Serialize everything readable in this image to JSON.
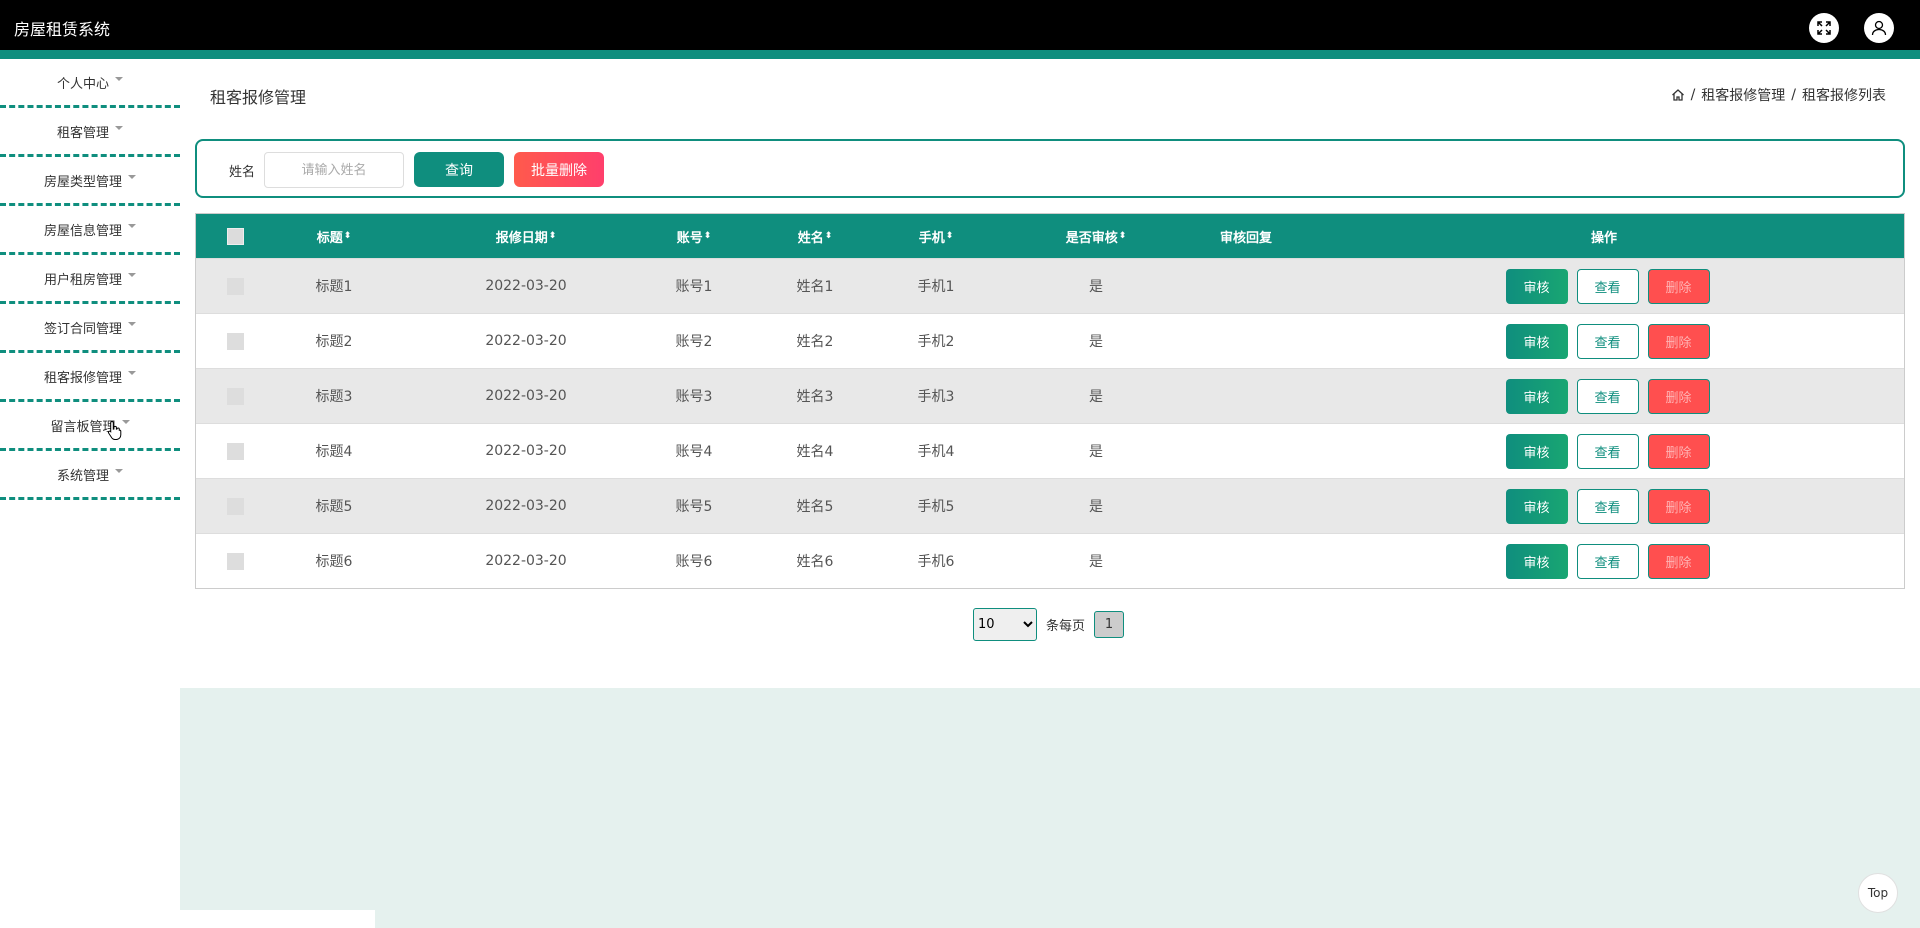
{
  "header": {
    "title": "房屋租赁系统",
    "fullscreen_icon": "fullscreen-icon",
    "user_icon": "user-icon"
  },
  "sidebar": {
    "items": [
      {
        "label": "个人中心"
      },
      {
        "label": "租客管理"
      },
      {
        "label": "房屋类型管理"
      },
      {
        "label": "房屋信息管理"
      },
      {
        "label": "用户租房管理"
      },
      {
        "label": "签订合同管理"
      },
      {
        "label": "租客报修管理"
      },
      {
        "label": "留言板管理"
      },
      {
        "label": "系统管理"
      }
    ]
  },
  "main": {
    "page_title": "租客报修管理",
    "breadcrumb": [
      "租客报修管理",
      "租客报修列表"
    ],
    "breadcrumb_sep": "/",
    "search": {
      "label": "姓名",
      "placeholder": "请输入姓名",
      "query_label": "查询",
      "batch_delete_label": "批量删除"
    },
    "table": {
      "columns": [
        "标题",
        "报修日期",
        "账号",
        "姓名",
        "手机",
        "是否审核",
        "审核回复",
        "操作"
      ],
      "sort_glyph": "⬍",
      "rows": [
        {
          "title": "标题1",
          "date": "2022-03-20",
          "account": "账号1",
          "name": "姓名1",
          "phone": "手机1",
          "audited": "是",
          "reply": ""
        },
        {
          "title": "标题2",
          "date": "2022-03-20",
          "account": "账号2",
          "name": "姓名2",
          "phone": "手机2",
          "audited": "是",
          "reply": ""
        },
        {
          "title": "标题3",
          "date": "2022-03-20",
          "account": "账号3",
          "name": "姓名3",
          "phone": "手机3",
          "audited": "是",
          "reply": ""
        },
        {
          "title": "标题4",
          "date": "2022-03-20",
          "account": "账号4",
          "name": "姓名4",
          "phone": "手机4",
          "audited": "是",
          "reply": ""
        },
        {
          "title": "标题5",
          "date": "2022-03-20",
          "account": "账号5",
          "name": "姓名5",
          "phone": "手机5",
          "audited": "是",
          "reply": ""
        },
        {
          "title": "标题6",
          "date": "2022-03-20",
          "account": "账号6",
          "name": "姓名6",
          "phone": "手机6",
          "audited": "是",
          "reply": ""
        }
      ],
      "actions": {
        "audit": "审核",
        "view": "查看",
        "delete": "删除"
      }
    },
    "pagination": {
      "page_size": "10",
      "per_page_label": "条每页",
      "current_page": "1"
    }
  },
  "top_button": "Top",
  "colors": {
    "accent": "#0f8e7e",
    "danger": "#ff4f4f",
    "header_bg": "#000000"
  }
}
